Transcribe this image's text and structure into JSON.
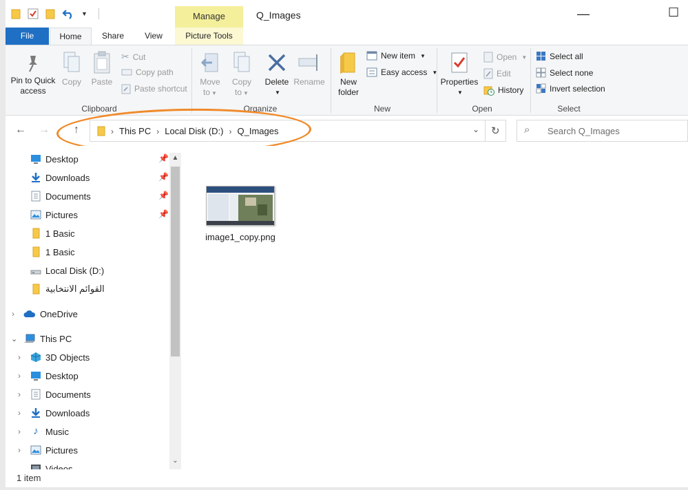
{
  "window": {
    "title": "Q_Images",
    "context_tab": "Manage",
    "maximize_glyph": "☐",
    "minimize_glyph": "—"
  },
  "tabs": {
    "file": "File",
    "home": "Home",
    "share": "Share",
    "view": "View",
    "picture_tools": "Picture Tools"
  },
  "ribbon": {
    "clipboard": {
      "label": "Clipboard",
      "pin_line1": "Pin to Quick",
      "pin_line2": "access",
      "copy": "Copy",
      "paste": "Paste",
      "cut": "Cut",
      "copy_path": "Copy path",
      "paste_shortcut": "Paste shortcut"
    },
    "organize": {
      "label": "Organize",
      "move_line1": "Move",
      "move_line2": "to",
      "copy_line1": "Copy",
      "copy_line2": "to",
      "delete": "Delete",
      "rename": "Rename"
    },
    "new": {
      "label": "New",
      "new_folder_line1": "New",
      "new_folder_line2": "folder",
      "new_item": "New item",
      "easy_access": "Easy access"
    },
    "open": {
      "label": "Open",
      "properties": "Properties",
      "open": "Open",
      "edit": "Edit",
      "history": "History"
    },
    "select": {
      "label": "Select",
      "select_all": "Select all",
      "select_none": "Select none",
      "invert_selection": "Invert selection"
    }
  },
  "address": {
    "crumbs": [
      "This PC",
      "Local Disk (D:)",
      "Q_Images"
    ],
    "search_placeholder": "Search Q_Images"
  },
  "nav_pane": {
    "quick_access": [
      {
        "label": "Desktop",
        "icon": "desktop-icon",
        "pinned": true
      },
      {
        "label": "Downloads",
        "icon": "downloads-icon",
        "pinned": true
      },
      {
        "label": "Documents",
        "icon": "documents-icon",
        "pinned": true
      },
      {
        "label": "Pictures",
        "icon": "pictures-icon",
        "pinned": true
      },
      {
        "label": "1 Basic",
        "icon": "folder-icon",
        "pinned": false
      },
      {
        "label": "1 Basic",
        "icon": "folder-icon",
        "pinned": false
      },
      {
        "label": "Local Disk (D:)",
        "icon": "drive-icon",
        "pinned": false
      },
      {
        "label": "القوائم الانتخابية",
        "icon": "folder-icon",
        "pinned": false
      }
    ],
    "onedrive": "OneDrive",
    "this_pc": "This PC",
    "this_pc_children": [
      {
        "label": "3D Objects",
        "icon": "3d-objects-icon"
      },
      {
        "label": "Desktop",
        "icon": "desktop-icon"
      },
      {
        "label": "Documents",
        "icon": "documents-icon"
      },
      {
        "label": "Downloads",
        "icon": "downloads-icon"
      },
      {
        "label": "Music",
        "icon": "music-icon"
      },
      {
        "label": "Pictures",
        "icon": "pictures-icon"
      },
      {
        "label": "Videos",
        "icon": "videos-icon"
      }
    ]
  },
  "content": {
    "files": [
      {
        "name": "image1_copy.png",
        "type": "png-thumbnail"
      }
    ]
  },
  "status": {
    "item_count": "1 item"
  },
  "colors": {
    "file_tab": "#1f6fc4",
    "manage_band": "#f4ef9b",
    "annotation": "#f08a2a",
    "folder": "#f7c948"
  }
}
